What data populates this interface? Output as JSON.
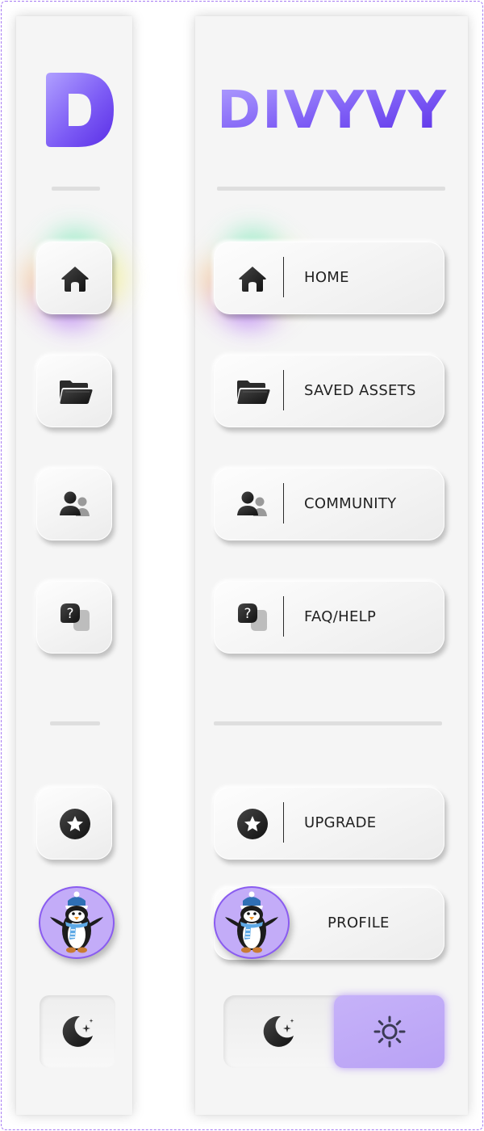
{
  "brand": {
    "logo_letter": "D",
    "wordmark": "DIVYVY",
    "colors": {
      "light": "#b0a0ff",
      "dark": "#5a2ee6"
    }
  },
  "nav": {
    "items": [
      {
        "id": "home",
        "label": "HOME",
        "icon": "home-icon",
        "active": true
      },
      {
        "id": "saved-assets",
        "label": "SAVED ASSETS",
        "icon": "folder-icon"
      },
      {
        "id": "community",
        "label": "COMMUNITY",
        "icon": "users-icon"
      },
      {
        "id": "faq-help",
        "label": "FAQ/HELP",
        "icon": "help-icon"
      }
    ]
  },
  "upgrade": {
    "label": "UPGRADE",
    "icon": "star-icon"
  },
  "profile": {
    "label": "PROFILE",
    "avatar": "penguin-avatar"
  },
  "theme": {
    "current": "light",
    "dark_icon": "moon-icon",
    "light_icon": "sun-icon",
    "accent": "#c3acf8"
  }
}
